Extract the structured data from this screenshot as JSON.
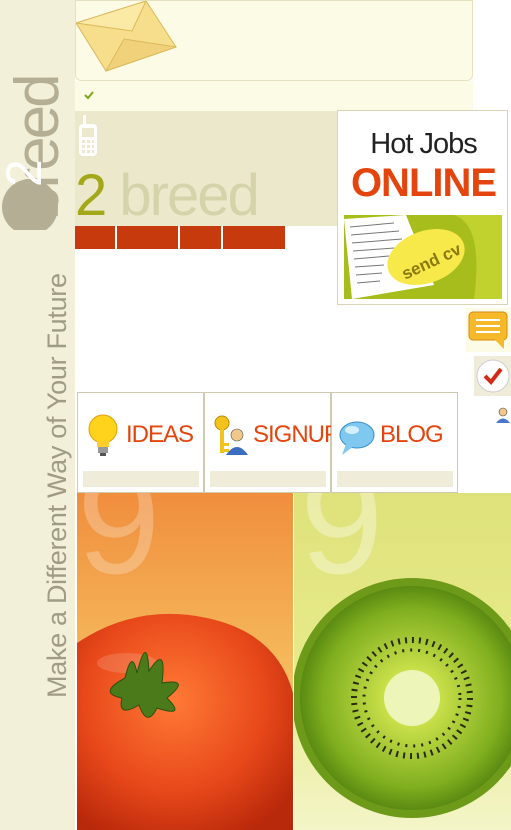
{
  "brand": {
    "side_logo_number": "2",
    "side_logo_word": "breed",
    "tagline": "Make a Different Way of Your Future",
    "logo_number": "2",
    "logo_word": "breed"
  },
  "nav": {
    "items": [
      {
        "label": ""
      },
      {
        "label": ""
      },
      {
        "label": ""
      },
      {
        "label": ""
      }
    ]
  },
  "hot_jobs": {
    "title": "Hot Jobs",
    "subtitle": "ONLINE",
    "send_label": "send cv"
  },
  "features": [
    {
      "label": "IDEAS",
      "icon": "lightbulb-icon"
    },
    {
      "label": "SIGNUP",
      "icon": "key-user-icon"
    },
    {
      "label": "BLOG",
      "icon": "speech-bubble-icon"
    }
  ],
  "colors": {
    "accent_orange": "#e4440d",
    "nav_red": "#c73a0e",
    "olive": "#a2a818",
    "sidebar_bg": "#f3f0d9"
  }
}
